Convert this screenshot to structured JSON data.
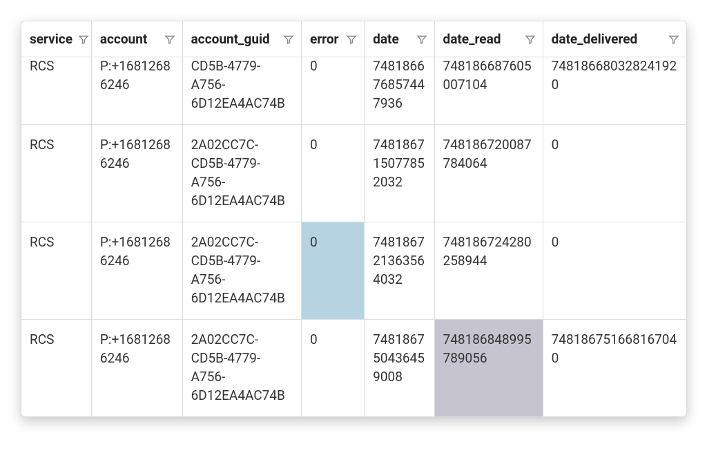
{
  "columns": [
    {
      "key": "service",
      "label": "service"
    },
    {
      "key": "account",
      "label": "account"
    },
    {
      "key": "account_guid",
      "label": "account_guid"
    },
    {
      "key": "error",
      "label": "error"
    },
    {
      "key": "date",
      "label": "date"
    },
    {
      "key": "date_read",
      "label": "date_read"
    },
    {
      "key": "date_delivered",
      "label": "date_delivered"
    }
  ],
  "rows": [
    {
      "service": "RCS",
      "account": "P:+16812686246",
      "account_guid": "CD5B-4779-A756-6D12EA4AC74B",
      "error": "0",
      "date": "748186676857447936",
      "date_read": "748186687605007104",
      "date_delivered": "748186680328241920"
    },
    {
      "service": "RCS",
      "account": "P:+16812686246",
      "account_guid": "2A02CC7C-CD5B-4779-A756-6D12EA4AC74B",
      "error": "0",
      "date": "748186715077852032",
      "date_read": "748186720087784064",
      "date_delivered": "0"
    },
    {
      "service": "RCS",
      "account": "P:+16812686246",
      "account_guid": "2A02CC7C-CD5B-4779-A756-6D12EA4AC74B",
      "error": "0",
      "date": "748186721363564032",
      "date_read": "748186724280258944",
      "date_delivered": "0"
    },
    {
      "service": "RCS",
      "account": "P:+16812686246",
      "account_guid": "2A02CC7C-CD5B-4779-A756-6D12EA4AC74B",
      "error": "0",
      "date": "748186750436459008",
      "date_read": "748186848995789056",
      "date_delivered": "748186751668167040"
    }
  ],
  "highlights": [
    {
      "row": 2,
      "col": "error",
      "class": "hl-blue"
    },
    {
      "row": 3,
      "col": "date_read",
      "class": "hl-gray"
    }
  ]
}
